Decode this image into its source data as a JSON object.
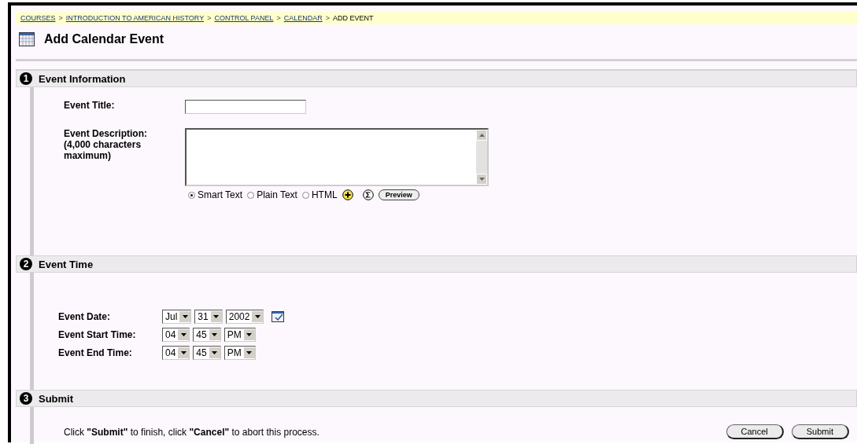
{
  "breadcrumb": [
    {
      "label": "COURSES",
      "kind": "link"
    },
    {
      "label": "INTRODUCTION TO AMERICAN HISTORY",
      "kind": "link"
    },
    {
      "label": "CONTROL PANEL",
      "kind": "link"
    },
    {
      "label": "CALENDAR",
      "kind": "link"
    },
    {
      "label": "ADD EVENT",
      "kind": "current"
    }
  ],
  "breadcrumb_separator": ">",
  "page_title": "Add Calendar Event",
  "sections": [
    {
      "number": "1",
      "title": "Event Information",
      "kind": "info",
      "title_field": {
        "label": "Event Title:"
      },
      "description_field": {
        "label": "Event Description:",
        "note": "(4,000 characters maximum)"
      },
      "formats": [
        {
          "label": "Smart Text",
          "selected": true
        },
        {
          "label": "Plain Text",
          "selected": false
        },
        {
          "label": "HTML",
          "selected": false
        }
      ],
      "preview_button": "Preview"
    },
    {
      "number": "2",
      "title": "Event Time",
      "kind": "time",
      "rows": [
        {
          "label": "Event Date:",
          "selects": [
            "Jul",
            "31",
            "2002"
          ],
          "calendar": true
        },
        {
          "label": "Event Start Time:",
          "selects": [
            "04",
            "45",
            "PM"
          ],
          "calendar": false
        },
        {
          "label": "Event End Time:",
          "selects": [
            "04",
            "45",
            "PM"
          ],
          "calendar": false
        }
      ]
    },
    {
      "number": "3",
      "title": "Submit",
      "kind": "submit",
      "instructions": "Click **\"Submit\"** to finish, click **\"Cancel\"** to abort this process.",
      "buttons": [
        "Cancel",
        "Submit"
      ]
    }
  ]
}
